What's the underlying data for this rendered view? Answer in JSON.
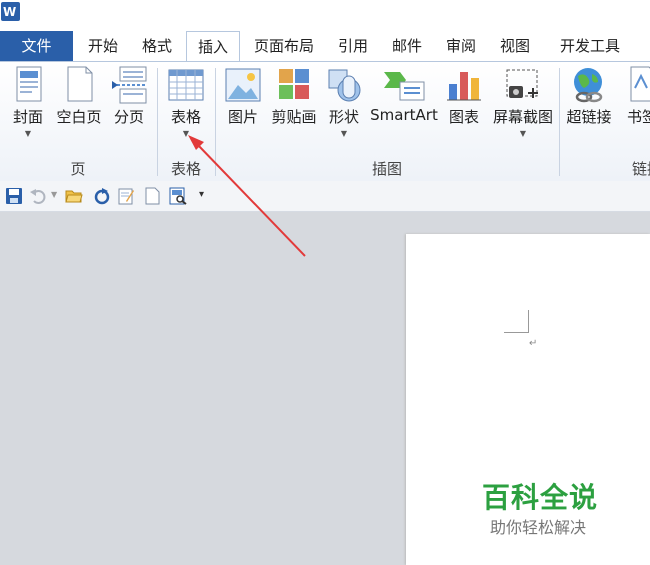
{
  "tabs": {
    "file": "文件",
    "home": "开始",
    "format": "格式",
    "insert": "插入",
    "page_layout": "页面布局",
    "references": "引用",
    "mailings": "邮件",
    "review": "审阅",
    "view": "视图",
    "developer": "开发工具"
  },
  "ribbon": {
    "pages_group": {
      "label": "页",
      "cover": "封面",
      "blank_page": "空白页",
      "page_break": "分页"
    },
    "tables_group": {
      "label": "表格",
      "table": "表格"
    },
    "illustrations_group": {
      "label": "插图",
      "picture": "图片",
      "clip_art": "剪贴画",
      "shapes": "形状",
      "smartart": "SmartArt",
      "chart": "图表",
      "screenshot": "屏幕截图"
    },
    "links_group": {
      "label": "链接",
      "hyperlink": "超链接",
      "bookmark": "书签"
    }
  },
  "document": {
    "paragraph_mark": "↵"
  },
  "watermark": {
    "title": "百科全说",
    "subtitle": "助你轻松解决"
  },
  "colors": {
    "file_tab": "#2a5fa9",
    "annotation_arrow": "#e23a3a",
    "watermark_green": "#2ca040"
  }
}
